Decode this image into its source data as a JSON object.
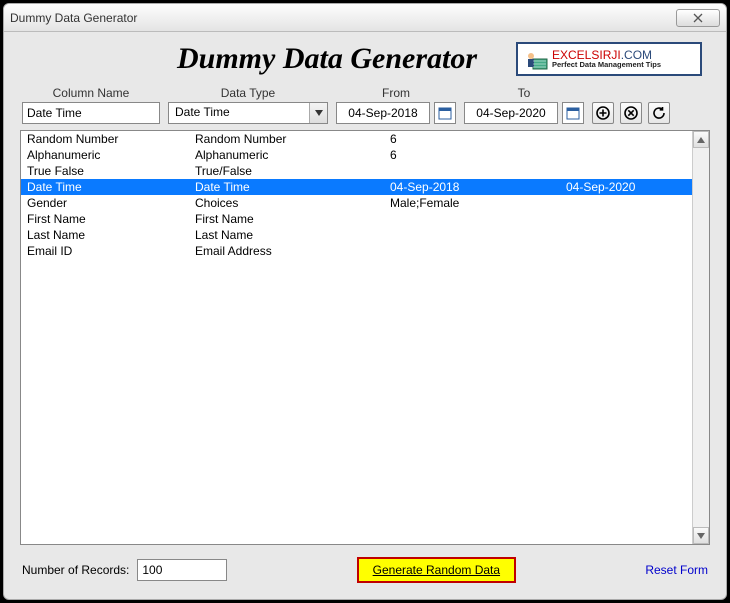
{
  "window": {
    "title": "Dummy Data Generator"
  },
  "header": {
    "title": "Dummy Data Generator",
    "logo_brand": "EXCELSIRJI",
    "logo_ext": ".COM",
    "logo_sub": "Perfect Data Management Tips"
  },
  "labels": {
    "column_name": "Column Name",
    "data_type": "Data Type",
    "from": "From",
    "to": "To"
  },
  "inputs": {
    "column_name_value": "Date Time",
    "data_type_value": "Date Time",
    "from_value": "04-Sep-2018",
    "to_value": "04-Sep-2020"
  },
  "list": {
    "selected_index": 3,
    "rows": [
      {
        "name": "Random Number",
        "type": "Random Number",
        "from": "6",
        "to": ""
      },
      {
        "name": "Alphanumeric",
        "type": "Alphanumeric",
        "from": "6",
        "to": ""
      },
      {
        "name": "True False",
        "type": "True/False",
        "from": "",
        "to": ""
      },
      {
        "name": "Date Time",
        "type": "Date Time",
        "from": "04-Sep-2018",
        "to": "04-Sep-2020"
      },
      {
        "name": "Gender",
        "type": "Choices",
        "from": "Male;Female",
        "to": ""
      },
      {
        "name": "First Name",
        "type": "First Name",
        "from": "",
        "to": ""
      },
      {
        "name": "Last Name",
        "type": "Last Name",
        "from": "",
        "to": ""
      },
      {
        "name": "Email ID",
        "type": "Email Address",
        "from": "",
        "to": ""
      }
    ]
  },
  "footer": {
    "num_records_label": "Number of Records:",
    "num_records_value": "100",
    "generate_label": "Generate Random Data",
    "reset_label": "Reset Form"
  }
}
